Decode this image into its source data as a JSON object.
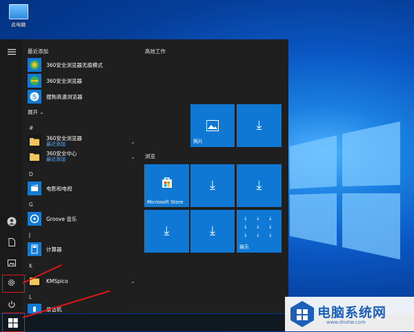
{
  "desktop": {
    "icon_label": "此电脑"
  },
  "start_menu": {
    "recent_header": "最近添加",
    "recent": [
      {
        "label": "360安全浏览器无痕模式",
        "icon": "360-private-icon"
      },
      {
        "label": "360安全浏览器",
        "icon": "360-browser-icon"
      },
      {
        "label": "搜狗高速浏览器",
        "icon": "sogou-icon"
      }
    ],
    "expand_label": "展开",
    "groups": [
      {
        "letter": "#",
        "items": [
          {
            "label": "360安全浏览器",
            "sub": "最近添加",
            "icon": "folder-icon",
            "chevron": true
          },
          {
            "label": "360安全中心",
            "sub": "最近添加",
            "icon": "folder-icon",
            "chevron": true
          }
        ]
      },
      {
        "letter": "D",
        "items": [
          {
            "label": "电影和电视",
            "icon": "film-icon"
          }
        ]
      },
      {
        "letter": "G",
        "items": [
          {
            "label": "Groove 音乐",
            "icon": "groove-icon"
          }
        ]
      },
      {
        "letter": "J",
        "items": [
          {
            "label": "计算器",
            "icon": "calculator-icon"
          }
        ]
      },
      {
        "letter": "K",
        "items": [
          {
            "label": "KMSpico",
            "icon": "folder-icon",
            "chevron": true
          }
        ]
      },
      {
        "letter": "L",
        "items": [
          {
            "label": "录音机",
            "icon": "recorder-icon"
          }
        ]
      }
    ],
    "tile_groups": {
      "work": "高效工作",
      "browse": "浏览"
    },
    "tiles": {
      "photos": "照片",
      "store": "Microsoft Store",
      "entertainment": "娱乐"
    }
  },
  "colors": {
    "tile": "#0e78d4",
    "accent": "#e01818"
  },
  "watermark": {
    "title": "电脑系统网",
    "url": "www.dnxtw.com"
  }
}
